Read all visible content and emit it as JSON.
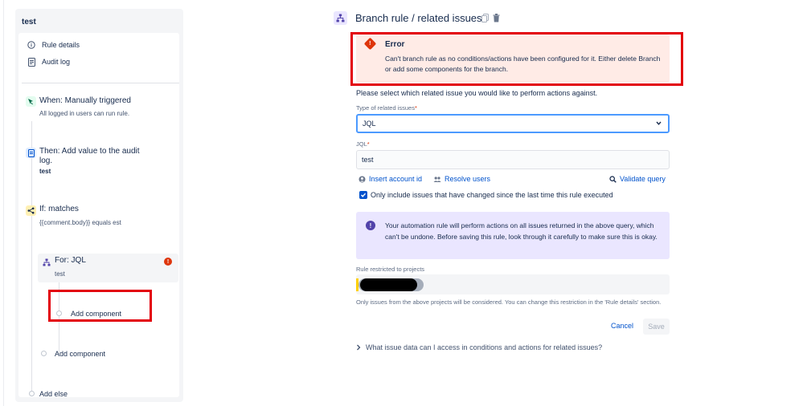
{
  "rule": {
    "name": "test"
  },
  "sidebar": {
    "rule_details": "Rule details",
    "audit_log": "Audit log"
  },
  "components": {
    "trigger": {
      "title": "When: Manually triggered",
      "subtitle": "All logged in users can run rule."
    },
    "action": {
      "title_line1": "Then: Add value to the audit",
      "title_line2": "log.",
      "value": "test"
    },
    "condition": {
      "title": "If: matches",
      "subtitle": "{{comment.body}} equals est"
    },
    "branch": {
      "title": "For: JQL",
      "subtitle": "test"
    },
    "add_component_inner": "Add component",
    "add_component_outer": "Add component",
    "add_else": "Add else"
  },
  "editor": {
    "title": "Branch rule / related issues",
    "error": {
      "title": "Error",
      "message": "Can't branch rule as no conditions/actions have been configured for it. Either delete Branch or add some components for the branch."
    },
    "instruction": "Please select which related issue you would like to perform actions against.",
    "type_label": "Type of related issues",
    "type_value": "JQL",
    "jql_label": "JQL",
    "jql_value": "test",
    "required_mark": "*",
    "links": {
      "insert_account_id": "Insert account id",
      "resolve_users": "Resolve users",
      "validate_query": "Validate query"
    },
    "only_changed_label": "Only include issues that have changed since the last time this rule executed",
    "only_changed_checked": true,
    "info_message": "Your automation rule will perform actions on all issues returned in the above query, which can't be undone. Before saving this rule, look through it carefully to make sure this is okay.",
    "restricted_label": "Rule restricted to projects",
    "restricted_helper": "Only issues from the above projects will be considered. You can change this restriction in the 'Rule details' section.",
    "cancel": "Cancel",
    "save": "Save",
    "faq": "What issue data can I access in conditions and actions for related issues?"
  },
  "colors": {
    "accent": "#0052cc",
    "error_bg": "#ffebe6",
    "error_icon": "#de350b",
    "info_bg": "#eae6ff",
    "info_icon": "#5243aa",
    "annotation_red": "#e3000b"
  },
  "icons": {
    "rule_details": "info-circle-icon",
    "audit_log": "document-icon",
    "trigger": "cursor-click-icon",
    "action": "audit-document-icon",
    "condition": "branch-condition-icon",
    "branch": "hierarchy-icon",
    "copy": "copy-icon",
    "delete": "trash-icon"
  }
}
